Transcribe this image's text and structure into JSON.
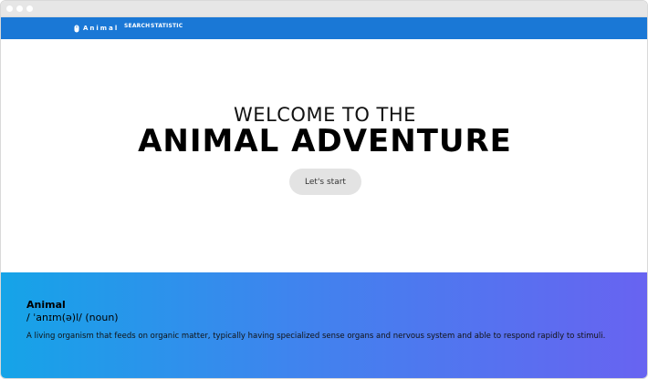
{
  "window": {
    "controls": [
      "close",
      "minimize",
      "maximize"
    ]
  },
  "navbar": {
    "brand_icon": "mouse-icon",
    "brand_text": "Animal",
    "links": [
      "SEARCH",
      "STATISTIC"
    ],
    "background": "#1a78d6"
  },
  "hero": {
    "subtitle": "WELCOME TO THE",
    "title": "ANIMAL ADVENTURE",
    "start_label": "Let's start"
  },
  "definition": {
    "word": "Animal",
    "pronunciation": "/ ˈanɪm(ə)l/ (noun)",
    "text": "A living organism that feeds on organic matter, typically having specialized sense organs and nervous system and able to respond rapidly to stimuli.",
    "gradient": [
      "#15a4e8",
      "#3f84ee",
      "#6863f1"
    ]
  }
}
